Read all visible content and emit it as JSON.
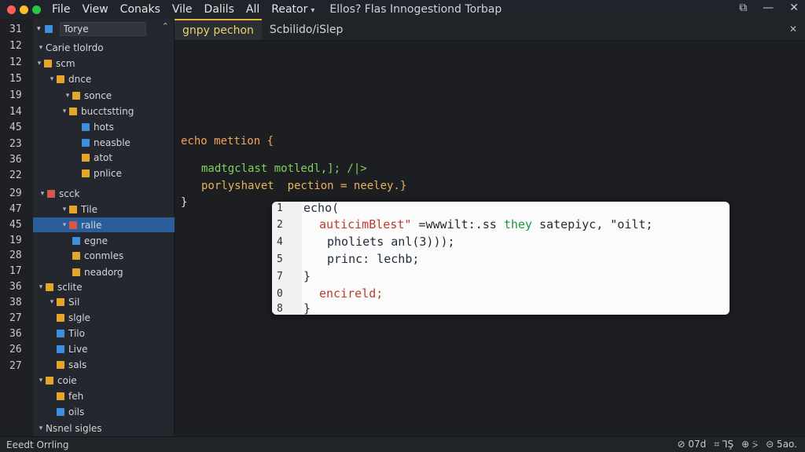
{
  "window": {
    "traffic_lights": {
      "close": "#ff5f57",
      "minimize": "#febc2e",
      "maximize": "#28c840"
    },
    "title": "Ellos? Flas Innogestiond Torbap",
    "controls": [
      "⧉",
      "—",
      "✕"
    ]
  },
  "menu": [
    "File",
    "View",
    "Conaks",
    "Vile",
    "Dalils",
    "All",
    "Reator"
  ],
  "gutter": [
    "31",
    "12",
    "12",
    "15",
    "19",
    "14",
    "45",
    "23",
    "36",
    "22",
    "29",
    "47",
    "45",
    "19",
    "28",
    "17",
    "36",
    "38",
    "27",
    "36",
    "26",
    "27"
  ],
  "sidebar": {
    "search_value": "Torye",
    "settings_icon": "⌃",
    "items": [
      {
        "label": "Carie tlolrdo",
        "caret": "▾",
        "icon": "",
        "selected": false
      },
      {
        "label": "scm",
        "caret": "▾",
        "icon": "folder",
        "selected": false
      },
      {
        "label": "dnce",
        "caret": "▾",
        "icon": "folder",
        "selected": false
      },
      {
        "label": "sonce",
        "caret": "▾",
        "icon": "folder",
        "selected": false
      },
      {
        "label": "bucctstting",
        "caret": "▾",
        "icon": "folder",
        "selected": false
      },
      {
        "label": "hots",
        "caret": "",
        "icon": "file-blue",
        "selected": false
      },
      {
        "label": "neasble",
        "caret": "",
        "icon": "file-blue",
        "selected": false
      },
      {
        "label": "atot",
        "caret": "",
        "icon": "folder",
        "selected": false
      },
      {
        "label": "pnlice",
        "caret": "",
        "icon": "folder",
        "selected": false
      },
      {
        "label": "scck",
        "caret": "▾",
        "icon": "file-red",
        "selected": false
      },
      {
        "label": "Tile",
        "caret": "▾",
        "icon": "folder",
        "selected": false
      },
      {
        "label": "ralle",
        "caret": "▾",
        "icon": "file-red",
        "selected": true
      },
      {
        "label": "egne",
        "caret": "",
        "icon": "file-blue",
        "selected": false
      },
      {
        "label": "conmles",
        "caret": "",
        "icon": "folder",
        "selected": false
      },
      {
        "label": "neadorg",
        "caret": "",
        "icon": "folder",
        "selected": false
      },
      {
        "label": "sclite",
        "caret": "▾",
        "icon": "folder",
        "selected": false
      },
      {
        "label": "Sil",
        "caret": "▾",
        "icon": "folder",
        "selected": false
      },
      {
        "label": "slgle",
        "caret": "",
        "icon": "folder",
        "selected": false
      },
      {
        "label": "Tilo",
        "caret": "",
        "icon": "file-blue",
        "selected": false
      },
      {
        "label": "Live",
        "caret": "",
        "icon": "file-blue",
        "selected": false
      },
      {
        "label": "sals",
        "caret": "",
        "icon": "folder",
        "selected": false
      },
      {
        "label": "coie",
        "caret": "▾",
        "icon": "folder",
        "selected": false
      },
      {
        "label": "feh",
        "caret": "",
        "icon": "folder",
        "selected": false
      },
      {
        "label": "oils",
        "caret": "",
        "icon": "file-blue",
        "selected": false
      },
      {
        "label": "Nsnel sigles",
        "caret": "▾",
        "icon": "",
        "selected": false
      }
    ]
  },
  "editor": {
    "tabs": [
      {
        "label": "gnpy pechon",
        "active": true
      },
      {
        "label": "Scbilido/iSlep",
        "active": false
      }
    ],
    "close_icon": "✕",
    "code_lines": [
      {
        "text": "echo mettion {",
        "color": "#f0a45a"
      },
      {
        "text": "madtgclast motledl,]; /|>",
        "color": "#7fd35a"
      },
      {
        "text": "porlyshavet  pection = neeley.}",
        "color": "#e8b35a"
      },
      {
        "text": "}",
        "color": "#e0e2e6"
      }
    ]
  },
  "popup": {
    "line_numbers": [
      "1",
      "2",
      "4",
      "5",
      "7",
      "0",
      "8"
    ],
    "lines": [
      {
        "segments": [
          {
            "text": "echo(",
            "color": "#1f2a37"
          }
        ]
      },
      {
        "segments": [
          {
            "text": "auticimBlest\"",
            "color": "#c0392b"
          },
          {
            "text": " =wwwilt:.ss ",
            "color": "#1f2a37"
          },
          {
            "text": "they",
            "color": "#1a9b3a"
          },
          {
            "text": " satepiyc, \"oilt;",
            "color": "#1f2a37"
          }
        ]
      },
      {
        "segments": [
          {
            "text": "pholiets anl(3)));",
            "color": "#1f2a37"
          }
        ]
      },
      {
        "segments": [
          {
            "text": "princ: lechb;",
            "color": "#1f2a37"
          }
        ]
      },
      {
        "segments": [
          {
            "text": "}",
            "color": "#1f2a37"
          }
        ]
      },
      {
        "segments": [
          {
            "text": "encireld;",
            "color": "#c0392b"
          }
        ]
      },
      {
        "segments": [
          {
            "text": "}",
            "color": "#1f2a37"
          }
        ]
      }
    ]
  },
  "statusbar": {
    "left": "Eeedt Orrling",
    "right": [
      "⊘ 07d",
      "⌗ ⅂Ş",
      "⊕ ⍩",
      "⊝ 5ao."
    ]
  }
}
